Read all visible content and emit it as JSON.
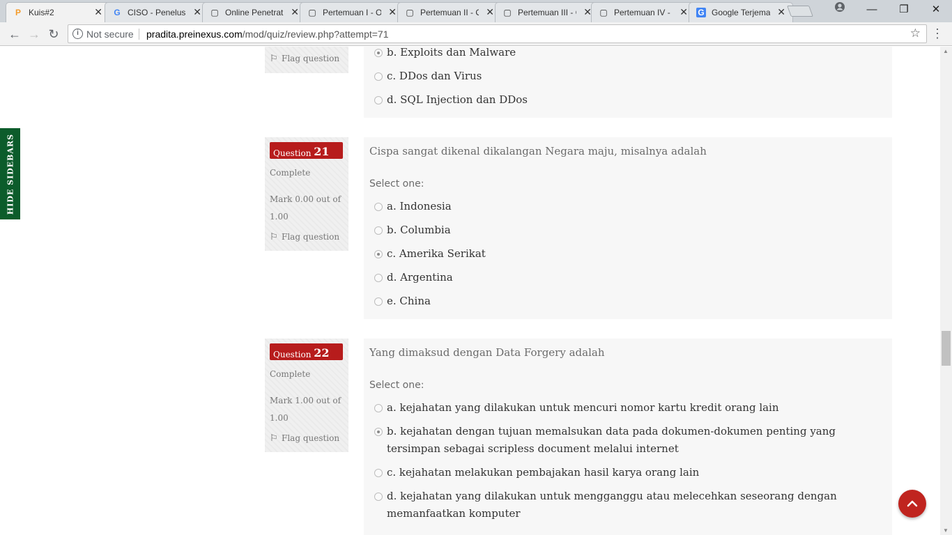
{
  "browser": {
    "tabs": [
      {
        "title": "Kuis#2",
        "icon": "moodle-icon",
        "icon_char": "P",
        "icon_color": "#f49b2b"
      },
      {
        "title": "CISO - Penelusuran",
        "icon": "google-icon",
        "icon_char": "G",
        "icon_color": "#4285f4"
      },
      {
        "title": "Online Penetration",
        "icon": "page-icon",
        "icon_char": "▢",
        "icon_color": "#555"
      },
      {
        "title": "Pertemuan I - Online",
        "icon": "page-icon",
        "icon_char": "▢",
        "icon_color": "#555"
      },
      {
        "title": "Pertemuan II - Online",
        "icon": "page-icon",
        "icon_char": "▢",
        "icon_color": "#555"
      },
      {
        "title": "Pertemuan III - Online",
        "icon": "page-icon",
        "icon_char": "▢",
        "icon_color": "#555"
      },
      {
        "title": "Pertemuan IV - Online",
        "icon": "page-icon",
        "icon_char": "▢",
        "icon_color": "#555"
      },
      {
        "title": "Google Terjemahan",
        "icon": "translate-icon",
        "icon_char": "G",
        "icon_color": "#4285f4"
      }
    ],
    "security_label": "Not secure",
    "url_host": "pradita.preinexus.com",
    "url_path": "/mod/quiz/review.php?attempt=71"
  },
  "page": {
    "hide_sidebars_label": "HIDE SIDEBARS",
    "prev_question": {
      "flag_label": "Flag question",
      "options": [
        {
          "text": "b. Exploits dan Malware",
          "checked": true
        },
        {
          "text": "c. DDos dan Virus",
          "checked": false
        },
        {
          "text": "d. SQL Injection dan DDos",
          "checked": false
        }
      ]
    },
    "questions": [
      {
        "label": "Question",
        "number": "21",
        "state": "Complete",
        "grade": "Mark 0.00 out of 1.00",
        "flag_label": "Flag question",
        "text": "Cispa sangat dikenal dikalangan Negara maju, misalnya adalah",
        "prompt": "Select one:",
        "options": [
          {
            "text": "a. Indonesia",
            "checked": false
          },
          {
            "text": "b. Columbia",
            "checked": false
          },
          {
            "text": "c. Amerika Serikat",
            "checked": true
          },
          {
            "text": "d. Argentina",
            "checked": false
          },
          {
            "text": "e. China",
            "checked": false
          }
        ]
      },
      {
        "label": "Question",
        "number": "22",
        "state": "Complete",
        "grade": "Mark 1.00 out of 1.00",
        "flag_label": "Flag question",
        "text": "Yang dimaksud dengan Data Forgery adalah",
        "prompt": "Select one:",
        "options": [
          {
            "text": "a. kejahatan yang dilakukan untuk mencuri nomor kartu kredit orang lain",
            "checked": false
          },
          {
            "text": "b. kejahatan dengan tujuan memalsukan data pada dokumen-dokumen penting yang tersimpan sebagai scripless document melalui internet",
            "checked": true
          },
          {
            "text": "c. kejahatan melakukan pembajakan hasil karya orang lain",
            "checked": false
          },
          {
            "text": "d. kejahatan yang dilakukan untuk mengganggu atau melecehkan seseorang dengan memanfaatkan komputer",
            "checked": false
          }
        ]
      }
    ],
    "back_to_top_icon": "chevron-up-icon",
    "accent_color": "#b71c1c"
  }
}
